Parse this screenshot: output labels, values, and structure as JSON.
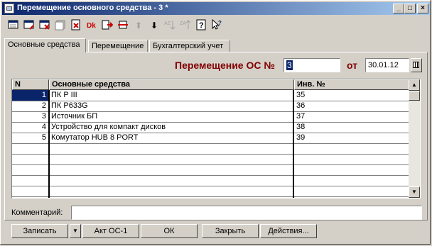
{
  "window": {
    "title": "Перемещение основного средства - 3 *",
    "minimize": "_",
    "maximize": "□",
    "close": "×"
  },
  "toolbar": {
    "icons": [
      "add-row-icon",
      "edit-row-icon",
      "delete-row-icon",
      "copy-row-icon",
      "mark-delete-icon",
      "dk-icon",
      "move-left-icon",
      "fill-icon",
      "arrow-up-icon",
      "arrow-down-icon",
      "sort-asc-icon",
      "sort-desc-icon",
      "help-icon",
      "context-help-icon"
    ]
  },
  "tabs": [
    {
      "label": "Основные средства",
      "active": true
    },
    {
      "label": "Перемещение",
      "active": false
    },
    {
      "label": "Бухгалтерский учет",
      "active": false
    }
  ],
  "header": {
    "doc_label": "Перемещение ОС №",
    "doc_number": "3",
    "date_label": "от",
    "date": "30.01.12"
  },
  "table": {
    "columns": [
      "N",
      "Основные средства",
      "Инв. №"
    ],
    "rows": [
      {
        "n": "1",
        "name": "ПК P III",
        "inv": "35"
      },
      {
        "n": "2",
        "name": "ПК P633G",
        "inv": "36"
      },
      {
        "n": "3",
        "name": "Источник БП",
        "inv": "37"
      },
      {
        "n": "4",
        "name": "Устройство для компакт дисков",
        "inv": "38"
      },
      {
        "n": "5",
        "name": "Комутатор HUB 8 PORT",
        "inv": "39"
      }
    ],
    "scroll_up": "▲",
    "scroll_down": "▼"
  },
  "comment": {
    "label": "Комментарий:",
    "value": ""
  },
  "buttons": {
    "save": "Записать",
    "dropdown": "▼",
    "act": "Акт ОС-1",
    "ok": "ОК",
    "close": "Закрыть",
    "actions": "Действия..."
  }
}
